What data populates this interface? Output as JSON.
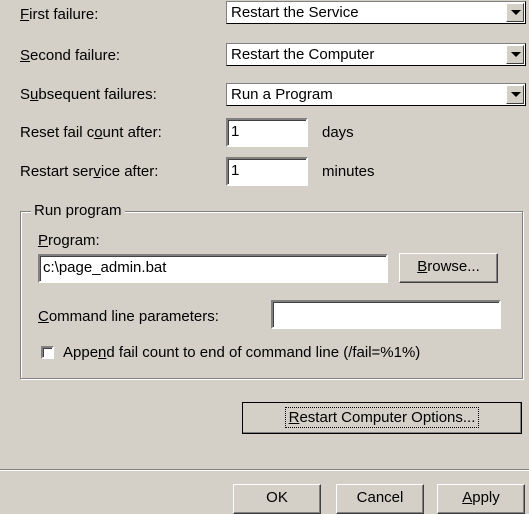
{
  "recovery": {
    "first_failure": {
      "label": "First failure:",
      "value": "Restart the Service"
    },
    "second_failure": {
      "label": "Second failure:",
      "value": "Restart the Computer"
    },
    "subsequent_failures": {
      "label": "Subsequent failures:",
      "value": "Run a Program"
    },
    "reset_fail_count": {
      "label": "Reset fail count after:",
      "value": "1",
      "unit": "days"
    },
    "restart_service": {
      "label": "Restart service after:",
      "value": "1",
      "unit": "minutes"
    }
  },
  "run_program": {
    "group_title": "Run program",
    "program_label": "Program:",
    "program_value": "c:\\page_admin.bat",
    "browse_label": "Browse...",
    "params_label": "Command line parameters:",
    "params_value": "",
    "append_checkbox_label": "Append fail count to end of command line (/fail=%1%)",
    "append_checked": false
  },
  "restart_options_label": "Restart Computer Options...",
  "dialog_buttons": {
    "ok": "OK",
    "cancel": "Cancel",
    "apply": "Apply"
  }
}
